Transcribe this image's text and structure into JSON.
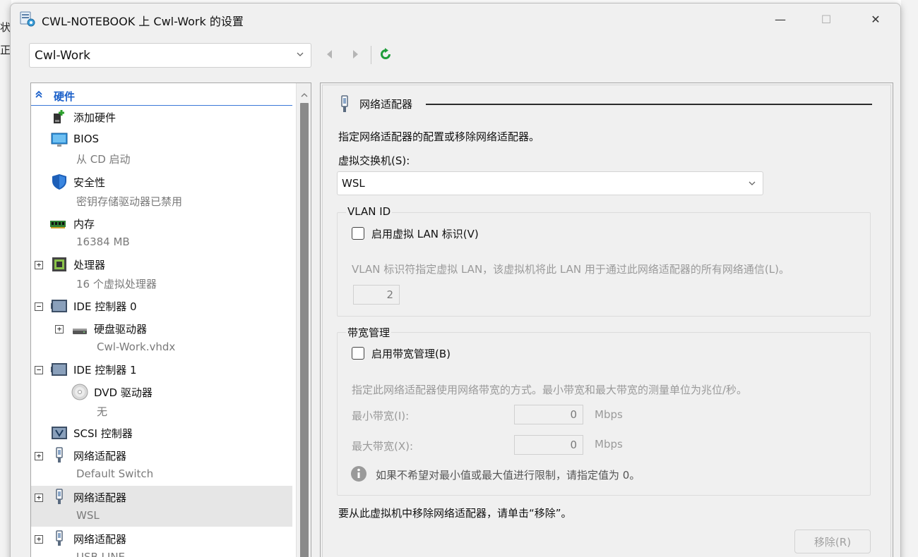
{
  "background": {
    "chars": [
      "状态",
      "正在"
    ]
  },
  "window": {
    "title": "CWL-NOTEBOOK 上 Cwl-Work 的设置",
    "minimize": "—",
    "maximize": "☐",
    "close": "✕"
  },
  "vm_selector": {
    "value": "Cwl-Work"
  },
  "tree": {
    "header": "硬件",
    "items": [
      {
        "label": "添加硬件",
        "sub": ""
      },
      {
        "label": "BIOS",
        "sub": "从 CD 启动"
      },
      {
        "label": "安全性",
        "sub": "密钥存储驱动器已禁用"
      },
      {
        "label": "内存",
        "sub": "16384 MB"
      },
      {
        "label": "处理器",
        "sub": "16 个虚拟处理器"
      },
      {
        "label": "IDE 控制器 0",
        "sub": ""
      },
      {
        "label": "硬盘驱动器",
        "sub": "Cwl-Work.vhdx"
      },
      {
        "label": "IDE 控制器 1",
        "sub": ""
      },
      {
        "label": "DVD 驱动器",
        "sub": "无"
      },
      {
        "label": "SCSI 控制器",
        "sub": ""
      },
      {
        "label": "网络适配器",
        "sub": "Default Switch"
      },
      {
        "label": "网络适配器",
        "sub": "WSL"
      },
      {
        "label": "网络适配器",
        "sub": "USB LINE"
      }
    ],
    "expand_plus": "+",
    "expand_minus": "−"
  },
  "pane": {
    "section_title": "网络适配器",
    "description": "指定网络适配器的配置或移除网络适配器。",
    "switch_label": "虚拟交换机(S):",
    "switch_value": "WSL",
    "vlan": {
      "group_title": "VLAN ID",
      "checkbox_label": "启用虚拟 LAN 标识(V)",
      "note": "VLAN 标识符指定虚拟 LAN，该虚拟机将此 LAN 用于通过此网络适配器的所有网络通信(L)。",
      "value": "2"
    },
    "bandwidth": {
      "group_title": "带宽管理",
      "checkbox_label": "启用带宽管理(B)",
      "note": "指定此网络适配器使用网络带宽的方式。最小带宽和最大带宽的测量单位为兆位/秒。",
      "min_label": "最小带宽(I):",
      "min_value": "0",
      "max_label": "最大带宽(X):",
      "max_value": "0",
      "unit": "Mbps",
      "info": "如果不希望对最小值或最大值进行限制，请指定值为 0。"
    },
    "remove_text": "要从此虚拟机中移除网络适配器，请单击“移除”。",
    "remove_button": "移除(R)"
  },
  "colors": {
    "accent_blue": "#1a5fc9",
    "refresh_green": "#1f9d3a",
    "selected_row": "#e6e6e6"
  },
  "icons": [
    "settings-app-icon",
    "chevron-down-icon",
    "back-arrow-icon",
    "forward-arrow-icon",
    "refresh-icon",
    "collapse-up-icon",
    "add-hardware-icon",
    "bios-monitor-icon",
    "security-shield-icon",
    "memory-icon",
    "processor-icon",
    "ide-controller-icon",
    "hard-drive-icon",
    "dvd-drive-icon",
    "scsi-controller-icon",
    "network-adapter-icon",
    "info-icon"
  ]
}
